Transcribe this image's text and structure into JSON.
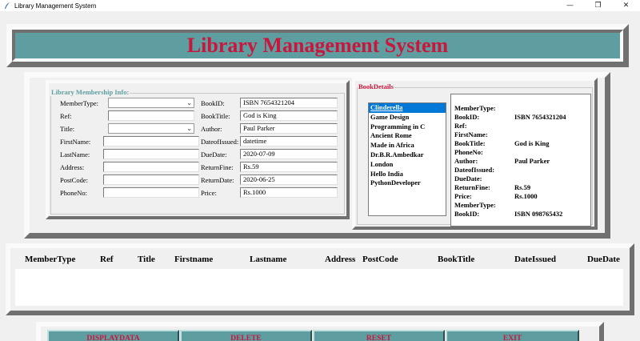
{
  "window": {
    "title": "Library Management System",
    "controls": {
      "minimize": "—",
      "maximize": "❐",
      "close": "✕"
    }
  },
  "header": {
    "title": "Library Management System"
  },
  "membership": {
    "group_title": "Library Membership Info:",
    "left_fields": [
      {
        "label": "MemberType:",
        "value": "",
        "kind": "combo"
      },
      {
        "label": "Ref:",
        "value": "",
        "kind": "entry"
      },
      {
        "label": "Title:",
        "value": "",
        "kind": "combo"
      },
      {
        "label": "FirstName:",
        "value": "",
        "kind": "entry"
      },
      {
        "label": "LastName:",
        "value": "",
        "kind": "entry"
      },
      {
        "label": "Address:",
        "value": "",
        "kind": "entry"
      },
      {
        "label": "PostCode:",
        "value": "",
        "kind": "entry"
      },
      {
        "label": "PhoneNo:",
        "value": "",
        "kind": "entry"
      }
    ],
    "right_fields": [
      {
        "label": "BookID:",
        "value": "ISBN 7654321204"
      },
      {
        "label": "BookTitle:",
        "value": "God is King"
      },
      {
        "label": "Author:",
        "value": "Paul Parker"
      },
      {
        "label": "DateofIssued:",
        "value": "datetime"
      },
      {
        "label": "DueDate:",
        "value": "2020-07-09"
      },
      {
        "label": "ReturnFine:",
        "value": "Rs.59"
      },
      {
        "label": "ReturnDate:",
        "value": "2020-06-25"
      },
      {
        "label": "Price:",
        "value": "Rs.1000"
      }
    ]
  },
  "book_details": {
    "group_title": "BookDetails",
    "books": [
      "Clinderella",
      "Game Design",
      "Programming in C",
      "Ancient Rome",
      "Made in Africa",
      "Dr.B.R.Ambedkar",
      "London",
      "Hello India",
      "PythonDeveloper"
    ],
    "selected_index": 0,
    "details": [
      {
        "label": "MemberType:",
        "value": ""
      },
      {
        "label": "BookID:",
        "value": "ISBN 7654321204"
      },
      {
        "label": "Ref:",
        "value": ""
      },
      {
        "label": "FirstName:",
        "value": ""
      },
      {
        "label": "BookTitle:",
        "value": "God is King"
      },
      {
        "label": "PhoneNo:",
        "value": ""
      },
      {
        "label": "Author:",
        "value": "Paul Parker"
      },
      {
        "label": "DateofIssued:",
        "value": ""
      },
      {
        "label": "DueDate:",
        "value": ""
      },
      {
        "label": "ReturnFine:",
        "value": "Rs.59"
      },
      {
        "label": "Price:",
        "value": "Rs.1000"
      },
      {
        "label": "MemberType:",
        "value": ""
      },
      {
        "label": "BookID:",
        "value": "ISBN 098765432"
      }
    ]
  },
  "records": {
    "columns": [
      "MemberType",
      "Ref",
      "Title",
      "Firstname",
      "Lastname",
      "Address",
      "PostCode",
      "BookTitle",
      "DateIssued",
      "DueDate"
    ],
    "rows": []
  },
  "buttons": {
    "display": "DISPLAYDATA",
    "delete": "DELETE",
    "reset": "RESET",
    "exit": "EXIT"
  },
  "colors": {
    "accent": "#5f9ea0",
    "title_text": "#c8163d",
    "selection": "#0078d7"
  }
}
